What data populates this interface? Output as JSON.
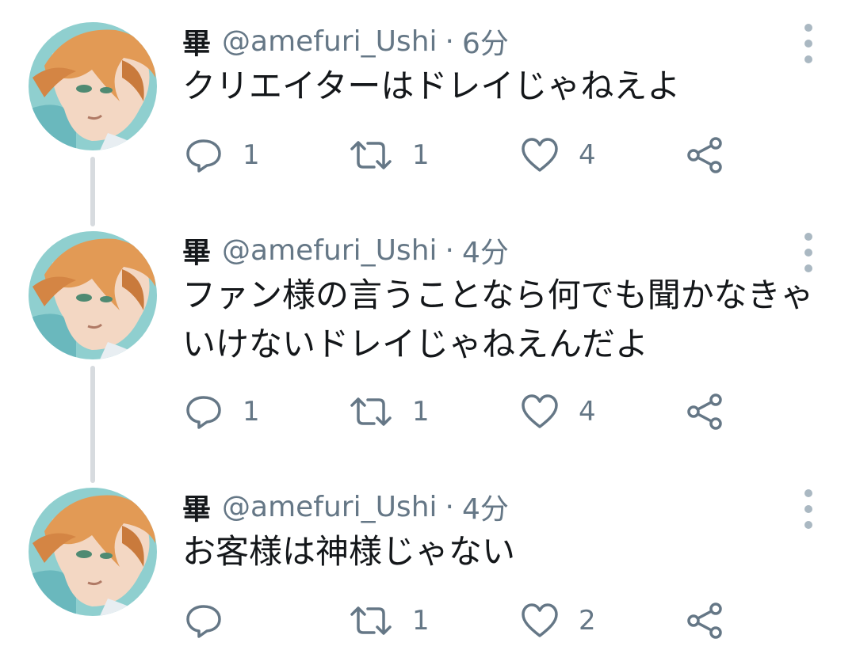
{
  "tweets": [
    {
      "display_name": "畢",
      "handle": "@amefuri_Ushi",
      "separator": "·",
      "time": "6分",
      "text": "クリエイターはドレイじゃねえよ",
      "reply_count": "1",
      "retweet_count": "1",
      "like_count": "4"
    },
    {
      "display_name": "畢",
      "handle": "@amefuri_Ushi",
      "separator": "·",
      "time": "4分",
      "text": "ファン様の言うことなら何でも聞かなきゃいけないドレイじゃねえんだよ",
      "reply_count": "1",
      "retweet_count": "1",
      "like_count": "4"
    },
    {
      "display_name": "畢",
      "handle": "@amefuri_Ushi",
      "separator": "·",
      "time": "4分",
      "text": "お客様は神様じゃない",
      "reply_count": "",
      "retweet_count": "1",
      "like_count": "2"
    }
  ],
  "icons": {
    "reply": "reply-icon",
    "retweet": "retweet-icon",
    "like": "heart-icon",
    "share": "share-icon",
    "more": "more-vertical-icon"
  },
  "colors": {
    "text_primary": "#14171a",
    "text_secondary": "#657786",
    "icon": "#657786",
    "thread_line": "#d7dbdf",
    "more_dots": "#aab8c2"
  }
}
